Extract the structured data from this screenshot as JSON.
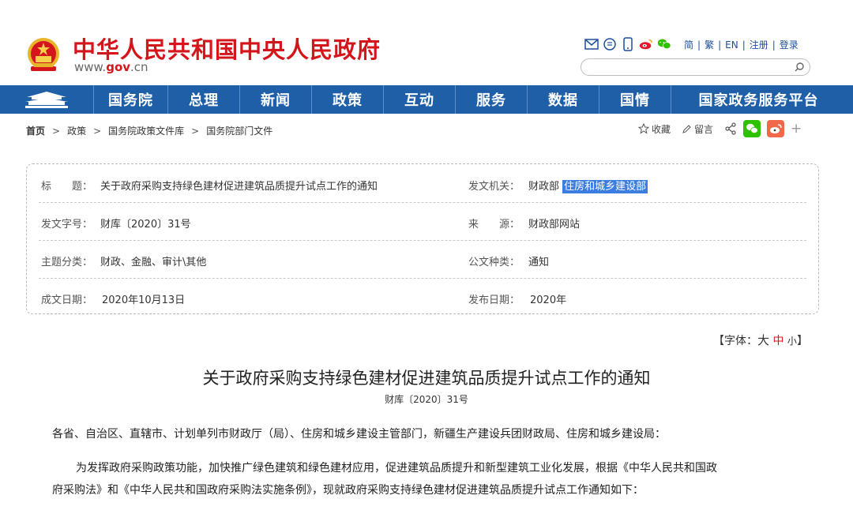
{
  "header": {
    "site_title": "中华人民共和国中央人民政府",
    "site_url_prefix": "www.",
    "site_url_domain": "gov",
    "site_url_suffix": ".cn",
    "lang_links": [
      "简",
      "繁",
      "EN",
      "注册",
      "登录"
    ],
    "search_placeholder": "",
    "icons": [
      "mail-icon",
      "message-icon",
      "mobile-icon",
      "weibo-icon",
      "wechat-icon"
    ]
  },
  "nav": {
    "items": [
      "国务院",
      "总理",
      "新闻",
      "政策",
      "互动",
      "服务",
      "数据",
      "国情",
      "国家政务服务平台"
    ]
  },
  "breadcrumb": {
    "items": [
      "首页",
      "政策",
      "国务院政策文件库",
      "国务院部门文件"
    ]
  },
  "share": {
    "favorite": "收藏",
    "comment": "留言",
    "plus": "+"
  },
  "info": {
    "title_label": "标　　题：",
    "title_value": "关于政府采购支持绿色建材促进建筑品质提升试点工作的通知",
    "issuer_label": "发文机关：",
    "issuer_value_1": "财政部",
    "issuer_value_2": "住房和城乡建设部",
    "doc_number_label": "发文字号：",
    "doc_number_value": "财库〔2020〕31号",
    "source_label": "来　　源：",
    "source_value": "财政部网站",
    "category_label": "主题分类：",
    "category_value": "财政、金融、审计\\其他",
    "doc_type_label": "公文种类：",
    "doc_type_value": "通知",
    "written_date_label": "成文日期：",
    "written_date_value": "2020年10月13日",
    "publish_date_label": "发布日期：",
    "publish_date_value": "2020年"
  },
  "fontsize": {
    "prefix": "【字体：",
    "large": "大",
    "medium": "中",
    "small": "小",
    "suffix": "】"
  },
  "article": {
    "title": "关于政府采购支持绿色建材促进建筑品质提升试点工作的通知",
    "doc_no": "财库〔2020〕31号",
    "salutation": "各省、自治区、直辖市、计划单列市财政厅（局）、住房和城乡建设主管部门，新疆生产建设兵团财政局、住房和城乡建设局：",
    "para1_line1": "为发挥政府采购政策功能，加快推广绿色建筑和绿色建材应用，促进建筑品质提升和新型建筑工业化发展，根据《中华人民共和国政",
    "para1_line2": "府采购法》和《中华人民共和国政府采购法实施条例》，现就政府采购支持绿色建材促进建筑品质提升试点工作通知如下："
  },
  "colors": {
    "brand_red": "#d4151b",
    "nav_blue": "#1e5fa8",
    "wechat_green": "#2dc100",
    "weibo_orange": "#f06a4a",
    "highlight_blue": "#3c7de0"
  }
}
